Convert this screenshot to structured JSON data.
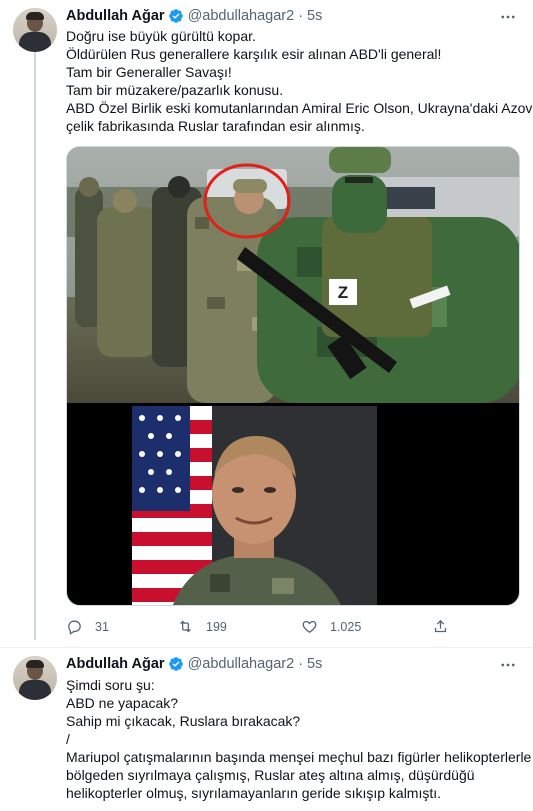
{
  "tweet1": {
    "author_name": "Abdullah Ağar",
    "handle": "@abdullahagar2",
    "separator": "·",
    "time": "5s",
    "lines": [
      "Doğru ise büyük gürültü kopar.",
      "Öldürülen Rus generallere karşılık esir alınan ABD'li general!",
      "Tam bir Generaller Savaşı!",
      "Tam bir müzakere/pazarlık konusu.",
      "ABD Özel Birlik eski komutanlarından Amiral Eric Olson, Ukrayna'daki Azov",
      "çelik fabrikasında Ruslar tarafından esir alınmış."
    ],
    "photo_patch_letter": "Z",
    "actions": {
      "reply_count": "31",
      "retweet_count": "199",
      "like_count": "1.025"
    }
  },
  "tweet2": {
    "author_name": "Abdullah Ağar",
    "handle": "@abdullahagar2",
    "separator": "·",
    "time": "5s",
    "lines": [
      "Şimdi soru şu:",
      "ABD ne yapacak?",
      "Sahip mi çıkacak, Ruslara bırakacak?",
      "/",
      "Mariupol çatışmalarının başında menşei meçhul bazı figürler helikopterlerle",
      "bölgeden sıyrılmaya çalışmış, Ruslar ateş altına almış, düşürdüğü",
      "helikopterler olmuş, sıyrılamayanların geride sıkışıp kalmıştı."
    ]
  },
  "colors": {
    "verified_blue": "#1d9bf0",
    "text": "#0f1419",
    "secondary": "#536471",
    "circle_red": "#e0201a"
  },
  "icons": [
    "verified-badge-icon",
    "more-icon",
    "reply-icon",
    "retweet-icon",
    "like-icon",
    "share-icon"
  ]
}
